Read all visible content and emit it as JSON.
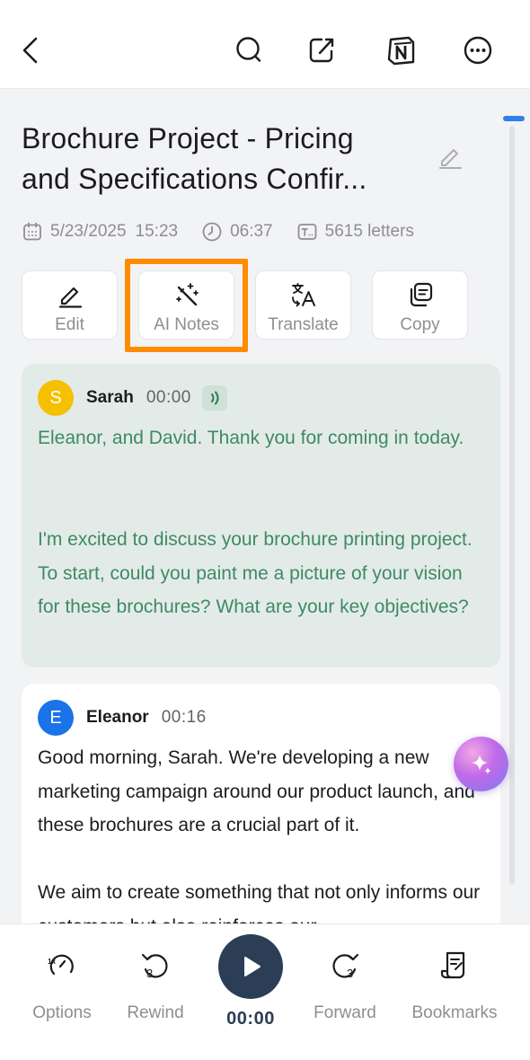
{
  "title": {
    "line1": "Brochure Project - Pricing",
    "line2": "and Specifications Confir..."
  },
  "meta": {
    "date": "5/23/2025",
    "time": "15:23",
    "duration": "06:37",
    "letters": "5615 letters"
  },
  "actions": [
    {
      "label": "Edit",
      "icon": "pencil-icon"
    },
    {
      "label": "AI Notes",
      "icon": "magic-wand-icon"
    },
    {
      "label": "Translate",
      "icon": "translate-icon"
    },
    {
      "label": "Copy",
      "icon": "copy-icon"
    }
  ],
  "transcript": [
    {
      "initial": "S",
      "name": "Sarah",
      "time": "00:00",
      "avatar_color": "#f5c000",
      "active": true,
      "paragraphs": [
        "Eleanor, and David. Thank you for coming in today.",
        "I'm excited to discuss your brochure printing project. To start, could you paint me a picture of your vision for these brochures? What are your key objectives?"
      ]
    },
    {
      "initial": "E",
      "name": "Eleanor",
      "time": "00:16",
      "avatar_color": "#1a73e8",
      "active": false,
      "paragraphs": [
        "Good morning, Sarah. We're developing a new marketing campaign around our product launch, and these brochures are a crucial part of it.",
        "We aim to create something that not only informs our customers but also reinforces our"
      ]
    }
  ],
  "bottom": {
    "options": "Options",
    "options_speed": "1x",
    "rewind": "Rewind",
    "rewind_seconds": "3",
    "play_time": "00:00",
    "forward": "Forward",
    "forward_seconds": "3",
    "bookmarks": "Bookmarks"
  },
  "colors": {
    "highlight": "#ff8c00",
    "active_text": "#3f8a63",
    "active_bg": "#e3ebe9",
    "play_button": "#2c3e55",
    "scroll_thumb": "#2f80ed"
  }
}
